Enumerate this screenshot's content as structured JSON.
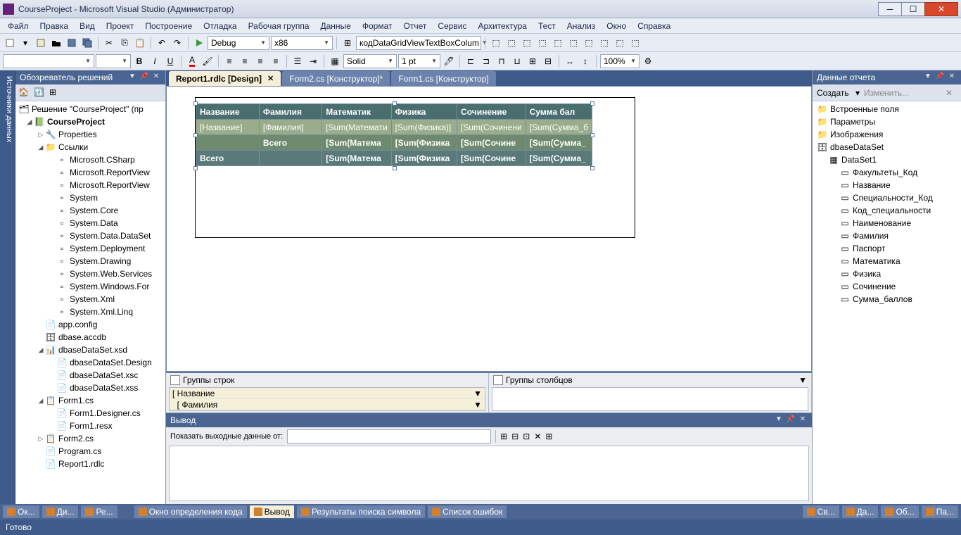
{
  "window": {
    "title": "CourseProject - Microsoft Visual Studio (Администратор)"
  },
  "menu": [
    "Файл",
    "Правка",
    "Вид",
    "Проект",
    "Построение",
    "Отладка",
    "Рабочая группа",
    "Данные",
    "Формат",
    "Отчет",
    "Сервис",
    "Архитектура",
    "Тест",
    "Анализ",
    "Окно",
    "Справка"
  ],
  "toolbar1": {
    "config": "Debug",
    "platform": "x86",
    "find": "кодDataGridViewTextBoxColum"
  },
  "toolbar2": {
    "lineStyle": "Solid",
    "lineWidth": "1 pt",
    "zoom": "100%"
  },
  "sideTab": "Источники данных",
  "solutionExplorer": {
    "title": "Обозреватель решений",
    "root": "Решение \"CourseProject\" (пр",
    "project": "CourseProject",
    "nodes": {
      "properties": "Properties",
      "references": "Ссылки",
      "refs": [
        "Microsoft.CSharp",
        "Microsoft.ReportView",
        "Microsoft.ReportView",
        "System",
        "System.Core",
        "System.Data",
        "System.Data.DataSet",
        "System.Deployment",
        "System.Drawing",
        "System.Web.Services",
        "System.Windows.For",
        "System.Xml",
        "System.Xml.Linq"
      ],
      "files": [
        "app.config",
        "dbase.accdb"
      ],
      "dataset": "dbaseDataSet.xsd",
      "dsFiles": [
        "dbaseDataSet.Design",
        "dbaseDataSet.xsc",
        "dbaseDataSet.xss"
      ],
      "form1": "Form1.cs",
      "form1Files": [
        "Form1.Designer.cs",
        "Form1.resx"
      ],
      "form2": "Form2.cs",
      "program": "Program.cs",
      "report": "Report1.rdlc"
    }
  },
  "tabs": [
    {
      "label": "Report1.rdlc [Design]",
      "active": true
    },
    {
      "label": "Form2.cs [Конструктор]*",
      "active": false
    },
    {
      "label": "Form1.cs [Конструктор]",
      "active": false
    }
  ],
  "report": {
    "headers": [
      "Название",
      "Фамилия",
      "Математик",
      "Физика",
      "Сочинение",
      "Сумма бал"
    ],
    "detail": [
      "[Название]",
      "[Фамилия]",
      "[Sum(Математи",
      "[Sum(Физика)]",
      "[Sum(Сочинени",
      "[Sum(Сумма_б"
    ],
    "subtotal": [
      "",
      "Всего",
      "[Sum(Матема",
      "[Sum(Физика",
      "[Sum(Сочине",
      "[Sum(Сумма_"
    ],
    "total": [
      "Всего",
      "",
      "[Sum(Матема",
      "[Sum(Физика",
      "[Sum(Сочине",
      "[Sum(Сумма_"
    ]
  },
  "groups": {
    "rowTitle": "Группы строк",
    "colTitle": "Группы столбцов",
    "rowGroups": [
      "Название",
      "Фамилия"
    ]
  },
  "output": {
    "title": "Вывод",
    "label": "Показать выходные данные от:"
  },
  "reportData": {
    "title": "Данные отчета",
    "create": "Создать",
    "edit": "Изменить...",
    "nodes": {
      "builtin": "Встроенные поля",
      "params": "Параметры",
      "images": "Изображения",
      "dataset": "dbaseDataSet",
      "ds1": "DataSet1",
      "fields": [
        "Факультеты_Код",
        "Название",
        "Специальности_Код",
        "Код_специальности",
        "Наименование",
        "Фамилия",
        "Паспорт",
        "Математика",
        "Физика",
        "Сочинение",
        "Сумма_баллов"
      ]
    }
  },
  "bottomTabs": {
    "left": [
      "Ок...",
      "Ди...",
      "Ре..."
    ],
    "center": [
      "Окно определения кода",
      "Вывод",
      "Результаты поиска символа",
      "Список ошибок"
    ],
    "right": [
      "Св...",
      "Да...",
      "Об...",
      "Па..."
    ]
  },
  "status": "Готово"
}
